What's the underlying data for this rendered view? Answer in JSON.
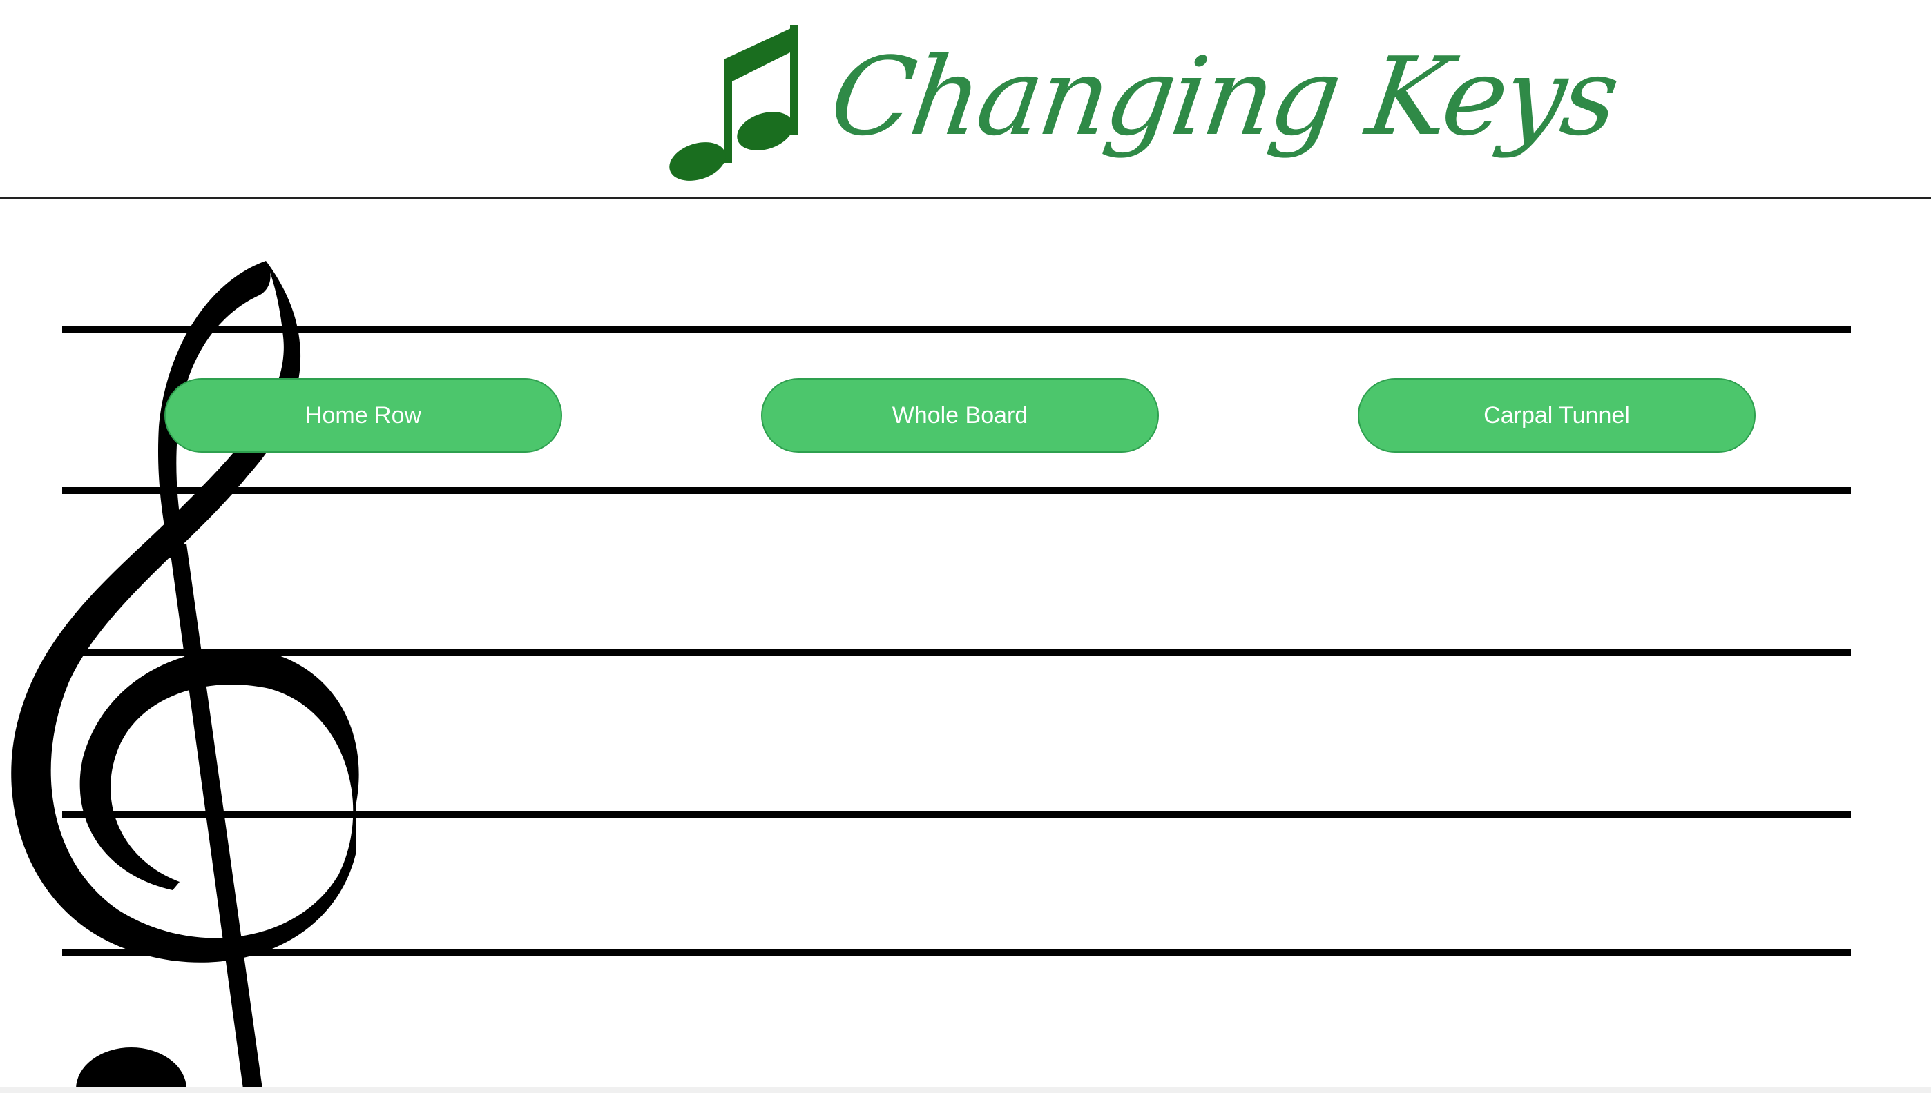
{
  "header": {
    "logo_text": "Changing Keys",
    "logo_icon": "music-note-icon",
    "brand_color": "#1f7a2a",
    "text_color": "#2f8a47"
  },
  "staff": {
    "icon": "treble-clef-icon",
    "line_color": "#000000"
  },
  "modes": {
    "home_row": "Home Row",
    "whole_board": "Whole Board",
    "carpal_tunnel": "Carpal Tunnel",
    "button_color": "#4cc66c"
  }
}
